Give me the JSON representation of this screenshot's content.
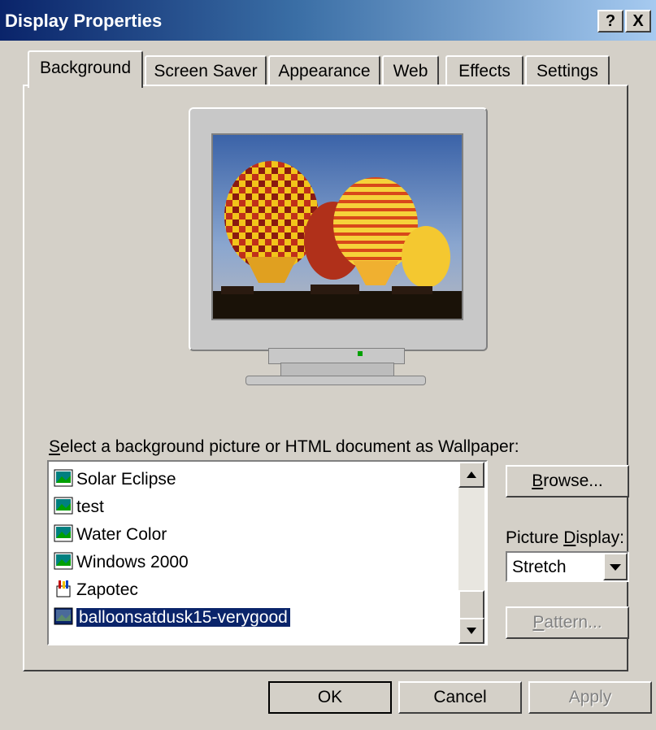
{
  "window": {
    "title": "Display Properties",
    "help_button": "?",
    "close_button": "X"
  },
  "tabs": [
    {
      "label": "Background",
      "active": true
    },
    {
      "label": "Screen Saver"
    },
    {
      "label": "Appearance"
    },
    {
      "label": "Web"
    },
    {
      "label": "Effects"
    },
    {
      "label": "Settings"
    }
  ],
  "wallpaper": {
    "label_pre": "",
    "label_u": "S",
    "label_post": "elect a background picture or HTML document as Wallpaper:",
    "items": [
      {
        "label": "Solar Eclipse",
        "icon": "image-icon"
      },
      {
        "label": "test",
        "icon": "image-icon"
      },
      {
        "label": "Water Color",
        "icon": "image-icon"
      },
      {
        "label": "Windows 2000",
        "icon": "image-icon"
      },
      {
        "label": "Zapotec",
        "icon": "paint-icon"
      },
      {
        "label": "balloonsatdusk15-verygood",
        "icon": "image-icon",
        "selected": true
      }
    ]
  },
  "browse": {
    "u": "B",
    "rest": "rowse..."
  },
  "picture_display": {
    "pre": "Picture ",
    "u": "D",
    "post": "isplay:",
    "value": "Stretch"
  },
  "pattern": {
    "u": "P",
    "rest": "attern..."
  },
  "footer": {
    "ok": "OK",
    "cancel": "Cancel",
    "apply": "Apply"
  },
  "colors": {
    "titlebar": "#0a246a",
    "face": "#d4d0c8",
    "selection": "#0a246a"
  }
}
